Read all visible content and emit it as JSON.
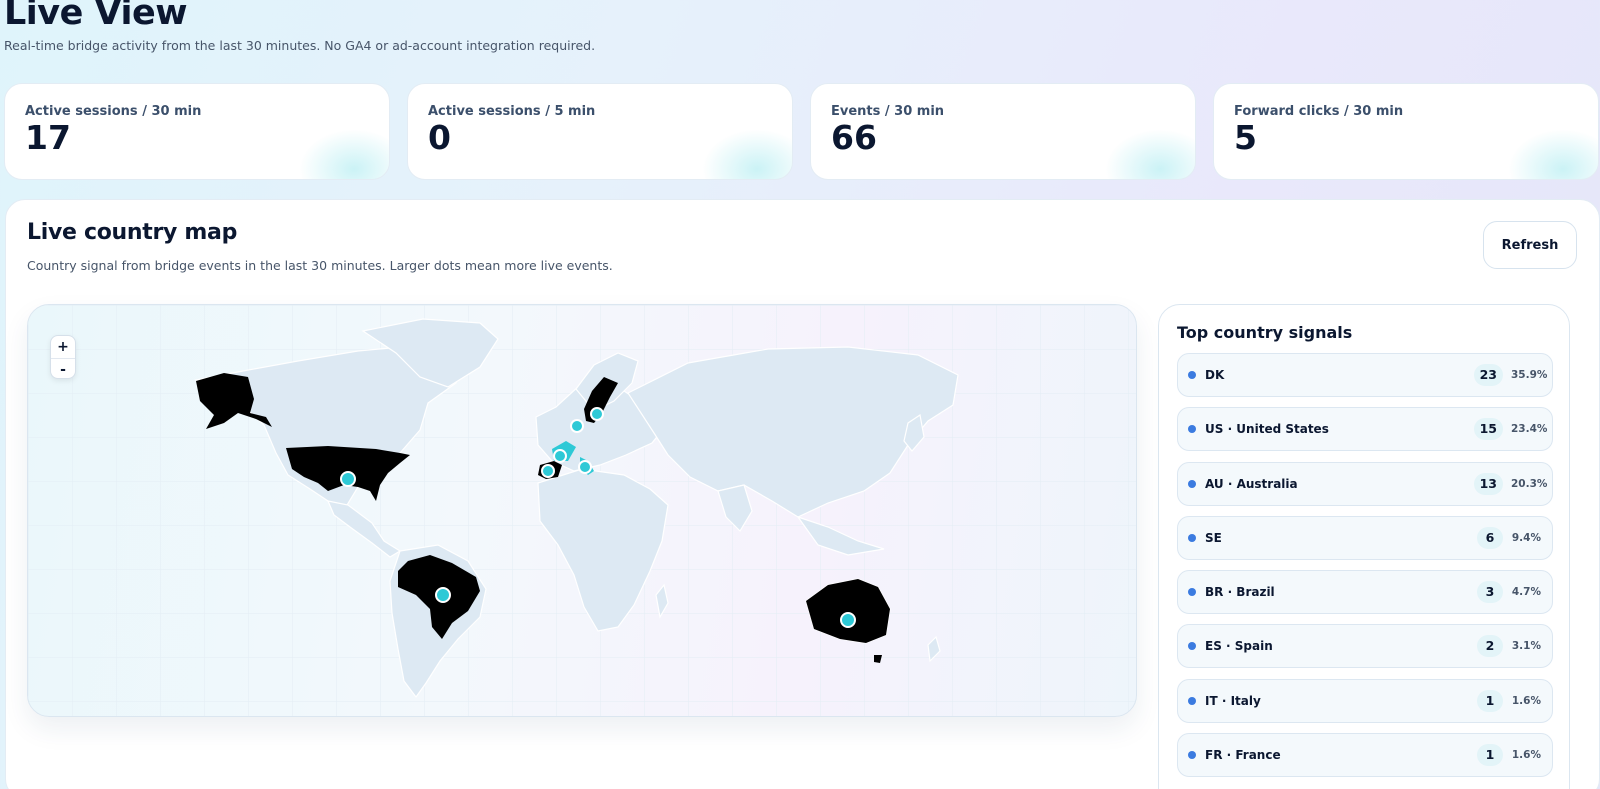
{
  "header": {
    "title": "Live View",
    "subtitle": "Real-time bridge activity from the last 30 minutes. No GA4 or ad-account integration required."
  },
  "stats": [
    {
      "label": "Active sessions / 30 min",
      "value": "17"
    },
    {
      "label": "Active sessions / 5 min",
      "value": "0"
    },
    {
      "label": "Events / 30 min",
      "value": "66"
    },
    {
      "label": "Forward clicks / 30 min",
      "value": "5"
    }
  ],
  "map_panel": {
    "title": "Live country map",
    "subtitle": "Country signal from bridge events in the last 30 minutes. Larger dots mean more live events.",
    "refresh_label": "Refresh",
    "zoom_in_label": "+",
    "zoom_out_label": "-"
  },
  "top_countries": {
    "title": "Top country signals",
    "items": [
      {
        "name": "DK",
        "count": "23",
        "pct": "35.9%"
      },
      {
        "name": "US · United States",
        "count": "15",
        "pct": "23.4%"
      },
      {
        "name": "AU · Australia",
        "count": "13",
        "pct": "20.3%"
      },
      {
        "name": "SE",
        "count": "6",
        "pct": "9.4%"
      },
      {
        "name": "BR · Brazil",
        "count": "3",
        "pct": "4.7%"
      },
      {
        "name": "ES · Spain",
        "count": "2",
        "pct": "3.1%"
      },
      {
        "name": "IT · Italy",
        "count": "1",
        "pct": "1.6%"
      },
      {
        "name": "FR · France",
        "count": "1",
        "pct": "1.6%"
      }
    ]
  },
  "colors": {
    "highlight_country": "#000000",
    "marker": "#2ec9d6",
    "land": "#dde9f3",
    "row_dot": "#3b7be0"
  }
}
